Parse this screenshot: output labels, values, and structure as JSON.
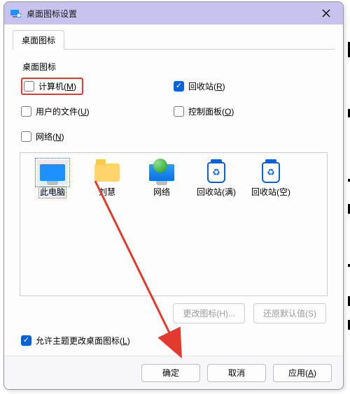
{
  "titlebar": {
    "title": "桌面图标设置",
    "icon_name": "monitor-settings-icon"
  },
  "tab": {
    "label": "桌面图标"
  },
  "group_label": "桌面图标",
  "checks": {
    "computer": {
      "label": "计算机(",
      "accel": "M",
      "suffix": ")",
      "checked": false
    },
    "recycle": {
      "label": "回收站(",
      "accel": "R",
      "suffix": ")",
      "checked": true
    },
    "userfiles": {
      "label": "用户的文件(",
      "accel": "U",
      "suffix": ")",
      "checked": false
    },
    "control": {
      "label": "控制面板(",
      "accel": "O",
      "suffix": ")",
      "checked": false
    },
    "network": {
      "label": "网络(",
      "accel": "N",
      "suffix": ")",
      "checked": false
    }
  },
  "preview_captions": {
    "this_pc": "此电脑",
    "user_folder": "刘慧",
    "network": "网络",
    "bin_full": "回收站(满)",
    "bin_empty": "回收站(空)"
  },
  "buttons": {
    "change_icon": "更改图标(H)...",
    "restore_default": "还原默认值(S)"
  },
  "allow_theme": {
    "label_prefix": "允许主题更改桌面图标(",
    "accel": "L",
    "suffix": ")",
    "checked": true
  },
  "footer": {
    "ok": "确定",
    "cancel": "取消",
    "apply_prefix": "应用(",
    "apply_accel": "A",
    "apply_suffix": ")"
  }
}
